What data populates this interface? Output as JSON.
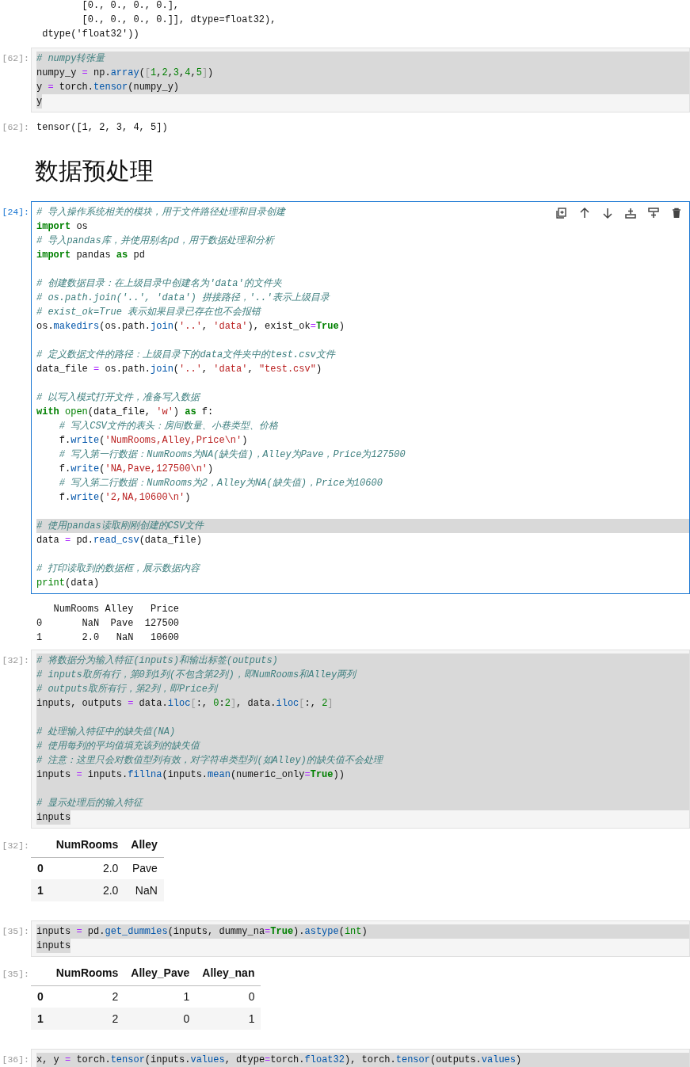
{
  "cells": [
    {
      "kind": "output_text",
      "lines": [
        "        [0., 0., 0., 0.],",
        "        [0., 0., 0., 0.]], dtype=float32),",
        " dtype('float32'))"
      ]
    },
    {
      "kind": "code",
      "prompt": "[62]:",
      "active": false,
      "lines": [
        {
          "highlighted": true,
          "highlight_full": true,
          "tokens": [
            {
              "kind": "comment",
              "text": "# numpy转张量"
            }
          ]
        },
        {
          "highlighted": true,
          "highlight_full": true,
          "tokens": [
            {
              "kind": "plain",
              "text": "numpy_y "
            },
            {
              "kind": "op",
              "text": "="
            },
            {
              "kind": "plain",
              "text": " np."
            },
            {
              "kind": "func",
              "text": "array"
            },
            {
              "kind": "plain",
              "text": "("
            },
            {
              "kind": "bracket",
              "text": "["
            },
            {
              "kind": "number",
              "text": "1"
            },
            {
              "kind": "plain",
              "text": ","
            },
            {
              "kind": "number",
              "text": "2"
            },
            {
              "kind": "plain",
              "text": ","
            },
            {
              "kind": "number",
              "text": "3"
            },
            {
              "kind": "plain",
              "text": ","
            },
            {
              "kind": "number",
              "text": "4"
            },
            {
              "kind": "plain",
              "text": ","
            },
            {
              "kind": "number",
              "text": "5"
            },
            {
              "kind": "bracket",
              "text": "]"
            },
            {
              "kind": "plain",
              "text": ")"
            }
          ]
        },
        {
          "highlighted": true,
          "highlight_full": true,
          "tokens": [
            {
              "kind": "plain",
              "text": "y "
            },
            {
              "kind": "op",
              "text": "="
            },
            {
              "kind": "plain",
              "text": " torch."
            },
            {
              "kind": "func",
              "text": "tensor"
            },
            {
              "kind": "plain",
              "text": "(numpy_y)"
            }
          ]
        },
        {
          "highlighted": true,
          "highlight_full": false,
          "tokens": [
            {
              "kind": "plain",
              "text": "y"
            }
          ]
        }
      ]
    },
    {
      "kind": "output_text",
      "prompt": "[62]:",
      "lines": [
        "tensor([1, 2, 3, 4, 5])"
      ]
    },
    {
      "kind": "heading",
      "text": "数据预处理"
    },
    {
      "kind": "code",
      "prompt": "[24]:",
      "active": true,
      "lines": [
        {
          "highlighted": false,
          "tokens": [
            {
              "kind": "comment",
              "text": "# 导入操作系统相关的模块，用于文件路径处理和目录创建"
            }
          ]
        },
        {
          "highlighted": false,
          "tokens": [
            {
              "kind": "keyword",
              "text": "import"
            },
            {
              "kind": "plain",
              "text": " os"
            }
          ]
        },
        {
          "highlighted": false,
          "tokens": [
            {
              "kind": "comment",
              "text": "# 导入pandas库，并使用别名pd，用于数据处理和分析"
            }
          ]
        },
        {
          "highlighted": false,
          "tokens": [
            {
              "kind": "keyword",
              "text": "import"
            },
            {
              "kind": "plain",
              "text": " pandas "
            },
            {
              "kind": "keyword",
              "text": "as"
            },
            {
              "kind": "plain",
              "text": " pd"
            }
          ]
        },
        {
          "highlighted": false
        },
        {
          "highlighted": false,
          "tokens": [
            {
              "kind": "comment",
              "text": "# 创建数据目录：在上级目录中创建名为'data'的文件夹"
            }
          ]
        },
        {
          "highlighted": false,
          "tokens": [
            {
              "kind": "comment",
              "text": "# os.path.join('..', 'data') 拼接路径，'..'表示上级目录"
            }
          ]
        },
        {
          "highlighted": false,
          "tokens": [
            {
              "kind": "comment",
              "text": "# exist_ok=True 表示如果目录已存在也不会报错"
            }
          ]
        },
        {
          "highlighted": false,
          "tokens": [
            {
              "kind": "plain",
              "text": "os."
            },
            {
              "kind": "func",
              "text": "makedirs"
            },
            {
              "kind": "plain",
              "text": "(os.path."
            },
            {
              "kind": "func",
              "text": "join"
            },
            {
              "kind": "plain",
              "text": "("
            },
            {
              "kind": "string",
              "text": "'..'"
            },
            {
              "kind": "plain",
              "text": ", "
            },
            {
              "kind": "string",
              "text": "'data'"
            },
            {
              "kind": "plain",
              "text": "), exist_ok"
            },
            {
              "kind": "op",
              "text": "="
            },
            {
              "kind": "keyword",
              "text": "True"
            },
            {
              "kind": "plain",
              "text": ")"
            }
          ]
        },
        {
          "highlighted": false
        },
        {
          "highlighted": false,
          "tokens": [
            {
              "kind": "comment",
              "text": "# 定义数据文件的路径：上级目录下的data文件夹中的test.csv文件"
            }
          ]
        },
        {
          "highlighted": false,
          "tokens": [
            {
              "kind": "plain",
              "text": "data_file "
            },
            {
              "kind": "op",
              "text": "="
            },
            {
              "kind": "plain",
              "text": " os.path."
            },
            {
              "kind": "func",
              "text": "join"
            },
            {
              "kind": "plain",
              "text": "("
            },
            {
              "kind": "string",
              "text": "'..'"
            },
            {
              "kind": "plain",
              "text": ", "
            },
            {
              "kind": "string",
              "text": "'data'"
            },
            {
              "kind": "plain",
              "text": ", "
            },
            {
              "kind": "string",
              "text": "\"test.csv\""
            },
            {
              "kind": "plain",
              "text": ")"
            }
          ]
        },
        {
          "highlighted": false
        },
        {
          "highlighted": false,
          "tokens": [
            {
              "kind": "comment",
              "text": "# 以写入模式打开文件，准备写入数据"
            }
          ]
        },
        {
          "highlighted": false,
          "tokens": [
            {
              "kind": "keyword",
              "text": "with"
            },
            {
              "kind": "builtin",
              "text": " open"
            },
            {
              "kind": "plain",
              "text": "(data_file, "
            },
            {
              "kind": "string",
              "text": "'w'"
            },
            {
              "kind": "plain",
              "text": ") "
            },
            {
              "kind": "keyword",
              "text": "as"
            },
            {
              "kind": "plain",
              "text": " f:"
            }
          ]
        },
        {
          "highlighted": false,
          "tokens": [
            {
              "kind": "comment",
              "text": "    # 写入CSV文件的表头：房间数量、小巷类型、价格"
            }
          ]
        },
        {
          "highlighted": false,
          "tokens": [
            {
              "kind": "plain",
              "text": "    f."
            },
            {
              "kind": "func",
              "text": "write"
            },
            {
              "kind": "plain",
              "text": "("
            },
            {
              "kind": "string",
              "text": "'NumRooms,Alley,Price\\n'"
            },
            {
              "kind": "plain",
              "text": ")"
            }
          ]
        },
        {
          "highlighted": false,
          "tokens": [
            {
              "kind": "comment",
              "text": "    # 写入第一行数据：NumRooms为NA(缺失值)，Alley为Pave，Price为127500"
            }
          ]
        },
        {
          "highlighted": false,
          "tokens": [
            {
              "kind": "plain",
              "text": "    f."
            },
            {
              "kind": "func",
              "text": "write"
            },
            {
              "kind": "plain",
              "text": "("
            },
            {
              "kind": "string",
              "text": "'NA,Pave,127500\\n'"
            },
            {
              "kind": "plain",
              "text": ")"
            }
          ]
        },
        {
          "highlighted": false,
          "tokens": [
            {
              "kind": "comment",
              "text": "    # 写入第二行数据：NumRooms为2，Alley为NA(缺失值)，Price为10600"
            }
          ]
        },
        {
          "highlighted": false,
          "tokens": [
            {
              "kind": "plain",
              "text": "    f."
            },
            {
              "kind": "func",
              "text": "write"
            },
            {
              "kind": "plain",
              "text": "("
            },
            {
              "kind": "string",
              "text": "'2,NA,10600\\n'"
            },
            {
              "kind": "plain",
              "text": ")"
            }
          ]
        },
        {
          "highlighted": false
        },
        {
          "highlighted": true,
          "highlight_full": true,
          "tokens": [
            {
              "kind": "comment",
              "text": "# 使用pandas读取刚刚创建的CSV文件"
            }
          ]
        },
        {
          "highlighted": false,
          "tokens": [
            {
              "kind": "plain",
              "text": "data "
            },
            {
              "kind": "op",
              "text": "="
            },
            {
              "kind": "plain",
              "text": " pd."
            },
            {
              "kind": "func",
              "text": "read_csv"
            },
            {
              "kind": "plain",
              "text": "(data_file)"
            }
          ]
        },
        {
          "highlighted": false
        },
        {
          "highlighted": false,
          "tokens": [
            {
              "kind": "comment",
              "text": "# 打印读取到的数据框，展示数据内容"
            }
          ]
        },
        {
          "highlighted": false,
          "tokens": [
            {
              "kind": "builtin",
              "text": "print"
            },
            {
              "kind": "plain",
              "text": "(data)"
            }
          ]
        }
      ]
    },
    {
      "kind": "output_text",
      "lines": [
        "   NumRooms Alley   Price",
        "0       NaN  Pave  127500",
        "1       2.0   NaN   10600"
      ]
    },
    {
      "kind": "code",
      "prompt": "[32]:",
      "active": false,
      "lines": [
        {
          "highlighted": true,
          "highlight_full": true,
          "tokens": [
            {
              "kind": "comment",
              "text": "# 将数据分为输入特征(inputs)和输出标签(outputs)"
            }
          ]
        },
        {
          "highlighted": true,
          "highlight_full": true,
          "tokens": [
            {
              "kind": "comment",
              "text": "# inputs取所有行，第0到1列(不包含第2列)，即NumRooms和Alley两列"
            }
          ]
        },
        {
          "highlighted": true,
          "highlight_full": true,
          "tokens": [
            {
              "kind": "comment",
              "text": "# outputs取所有行，第2列，即Price列"
            }
          ]
        },
        {
          "highlighted": true,
          "highlight_full": true,
          "tokens": [
            {
              "kind": "plain",
              "text": "inputs, outputs "
            },
            {
              "kind": "op",
              "text": "="
            },
            {
              "kind": "plain",
              "text": " data."
            },
            {
              "kind": "func",
              "text": "iloc"
            },
            {
              "kind": "bracket",
              "text": "["
            },
            {
              "kind": "plain",
              "text": ":, "
            },
            {
              "kind": "number",
              "text": "0"
            },
            {
              "kind": "plain",
              "text": ":"
            },
            {
              "kind": "number",
              "text": "2"
            },
            {
              "kind": "bracket",
              "text": "]"
            },
            {
              "kind": "plain",
              "text": ", data."
            },
            {
              "kind": "func",
              "text": "iloc"
            },
            {
              "kind": "bracket",
              "text": "["
            },
            {
              "kind": "plain",
              "text": ":, "
            },
            {
              "kind": "number",
              "text": "2"
            },
            {
              "kind": "bracket",
              "text": "]"
            }
          ]
        },
        {
          "highlighted": true,
          "highlight_full": true
        },
        {
          "highlighted": true,
          "highlight_full": true,
          "tokens": [
            {
              "kind": "comment",
              "text": "# 处理输入特征中的缺失值(NA)"
            }
          ]
        },
        {
          "highlighted": true,
          "highlight_full": true,
          "tokens": [
            {
              "kind": "comment",
              "text": "# 使用每列的平均值填充该列的缺失值"
            }
          ]
        },
        {
          "highlighted": true,
          "highlight_full": true,
          "tokens": [
            {
              "kind": "comment",
              "text": "# 注意：这里只会对数值型列有效，对字符串类型列(如Alley)的缺失值不会处理"
            }
          ]
        },
        {
          "highlighted": true,
          "highlight_full": true,
          "tokens": [
            {
              "kind": "plain",
              "text": "inputs "
            },
            {
              "kind": "op",
              "text": "="
            },
            {
              "kind": "plain",
              "text": " inputs."
            },
            {
              "kind": "func",
              "text": "fillna"
            },
            {
              "kind": "plain",
              "text": "(inputs."
            },
            {
              "kind": "func",
              "text": "mean"
            },
            {
              "kind": "plain",
              "text": "(numeric_only"
            },
            {
              "kind": "op",
              "text": "="
            },
            {
              "kind": "keyword",
              "text": "True"
            },
            {
              "kind": "plain",
              "text": "))"
            }
          ]
        },
        {
          "highlighted": true,
          "highlight_full": true
        },
        {
          "highlighted": true,
          "highlight_full": true,
          "tokens": [
            {
              "kind": "comment",
              "text": "# 显示处理后的输入特征"
            }
          ]
        },
        {
          "highlighted": true,
          "highlight_full": false,
          "tokens": [
            {
              "kind": "plain",
              "text": "inputs"
            }
          ]
        }
      ]
    },
    {
      "kind": "output_table",
      "prompt": "[32]:",
      "columns": [
        "NumRooms",
        "Alley"
      ],
      "rows": [
        {
          "index": "0",
          "values": [
            "2.0",
            "Pave"
          ]
        },
        {
          "index": "1",
          "values": [
            "2.0",
            "NaN"
          ]
        }
      ]
    },
    {
      "kind": "code",
      "prompt": "[35]:",
      "active": false,
      "lines": [
        {
          "highlighted": true,
          "highlight_full": true,
          "tokens": [
            {
              "kind": "plain",
              "text": "inputs "
            },
            {
              "kind": "op",
              "text": "="
            },
            {
              "kind": "plain",
              "text": " pd."
            },
            {
              "kind": "func",
              "text": "get_dummies"
            },
            {
              "kind": "plain",
              "text": "(inputs, dummy_na"
            },
            {
              "kind": "op",
              "text": "="
            },
            {
              "kind": "keyword",
              "text": "True"
            },
            {
              "kind": "plain",
              "text": ")."
            },
            {
              "kind": "func",
              "text": "astype"
            },
            {
              "kind": "plain",
              "text": "("
            },
            {
              "kind": "builtin",
              "text": "int"
            },
            {
              "kind": "plain",
              "text": ")"
            }
          ]
        },
        {
          "highlighted": true,
          "highlight_full": false,
          "tokens": [
            {
              "kind": "plain",
              "text": "inputs"
            }
          ]
        }
      ]
    },
    {
      "kind": "output_table",
      "prompt": "[35]:",
      "columns": [
        "NumRooms",
        "Alley_Pave",
        "Alley_nan"
      ],
      "rows": [
        {
          "index": "0",
          "values": [
            "2",
            "1",
            "0"
          ]
        },
        {
          "index": "1",
          "values": [
            "2",
            "0",
            "1"
          ]
        }
      ]
    },
    {
      "kind": "code",
      "prompt": "[36]:",
      "active": false,
      "lines": [
        {
          "highlighted": true,
          "highlight_full": true,
          "tokens": [
            {
              "kind": "plain",
              "text": "x, y "
            },
            {
              "kind": "op",
              "text": "="
            },
            {
              "kind": "plain",
              "text": " torch."
            },
            {
              "kind": "func",
              "text": "tensor"
            },
            {
              "kind": "plain",
              "text": "(inputs."
            },
            {
              "kind": "func",
              "text": "values"
            },
            {
              "kind": "plain",
              "text": ", dtype"
            },
            {
              "kind": "op",
              "text": "="
            },
            {
              "kind": "plain",
              "text": "torch."
            },
            {
              "kind": "func",
              "text": "float32"
            },
            {
              "kind": "plain",
              "text": "), torch."
            },
            {
              "kind": "func",
              "text": "tensor"
            },
            {
              "kind": "plain",
              "text": "(outputs."
            },
            {
              "kind": "func",
              "text": "values"
            },
            {
              "kind": "plain",
              "text": ")"
            }
          ]
        }
      ]
    }
  ]
}
